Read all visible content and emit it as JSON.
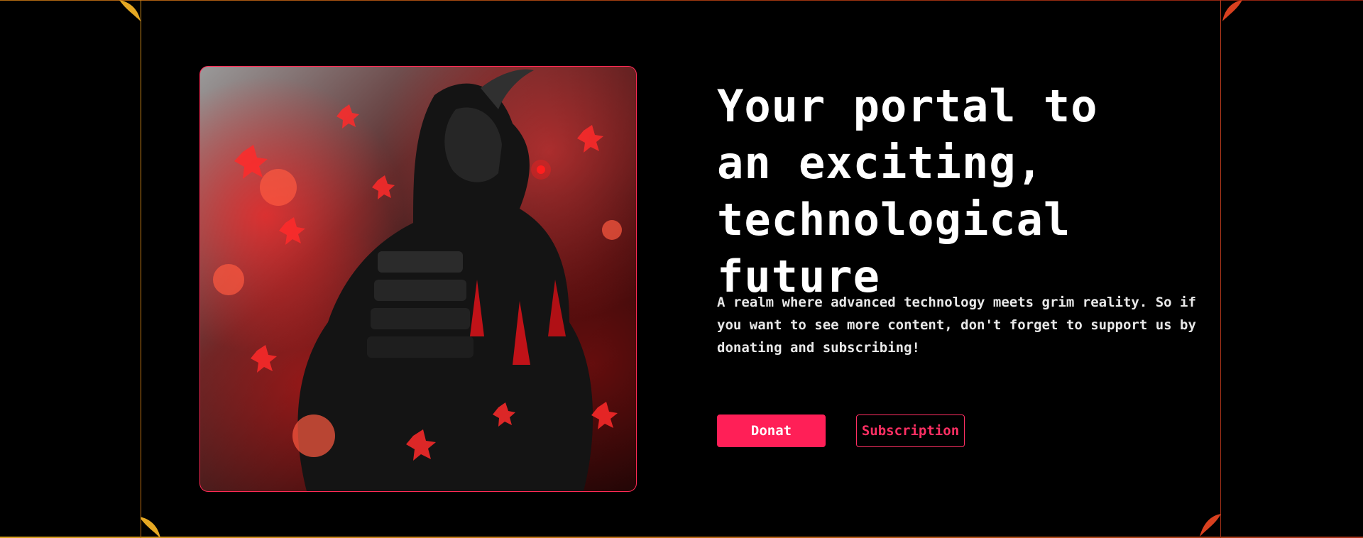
{
  "hero": {
    "image_alt": "samurai-warrior-red-leaves",
    "headline": "Your portal to an exciting, technological future",
    "description": "A realm where advanced technology meets grim reality. So if you want to see more content, don't forget to support us by donating and subscribing!",
    "primary_button": "Donat",
    "secondary_button": "Subscription"
  },
  "colors": {
    "background": "#000000",
    "accent": "#ff1f57",
    "frame_left": "#c9891a",
    "frame_right": "#b63a1c"
  }
}
